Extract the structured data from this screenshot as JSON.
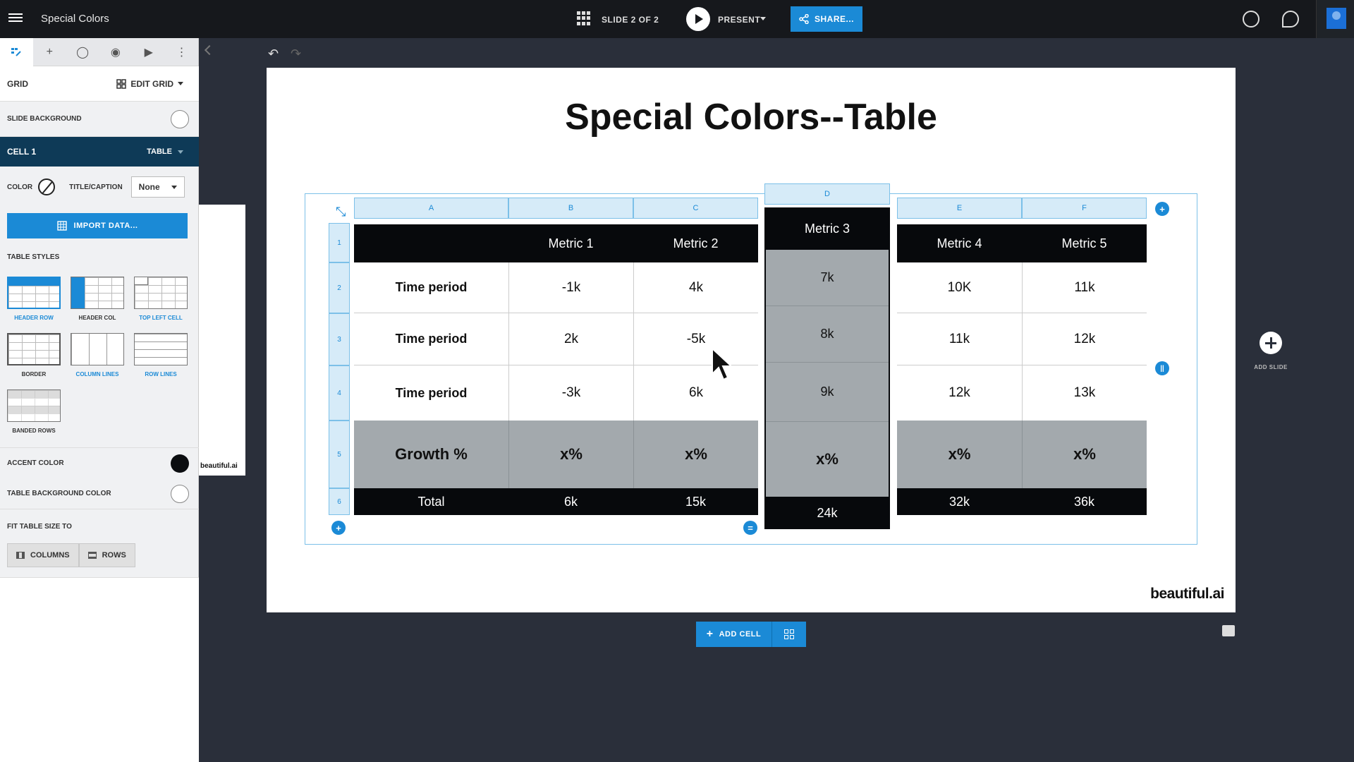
{
  "topbar": {
    "title": "Special Colors",
    "slide_counter": "SLIDE 2 OF 2",
    "present_label": "PRESENT",
    "share_label": "SHARE..."
  },
  "panel": {
    "grid_label": "GRID",
    "edit_grid_label": "EDIT GRID",
    "slide_background_label": "SLIDE BACKGROUND",
    "cell_label": "CELL 1",
    "cell_type": "TABLE",
    "color_label": "COLOR",
    "title_caption_label": "TITLE/CAPTION",
    "title_caption_value": "None",
    "import_label": "IMPORT DATA...",
    "table_styles_label": "TABLE STYLES",
    "styles": [
      {
        "label": "HEADER ROW"
      },
      {
        "label": "HEADER COL"
      },
      {
        "label": "TOP LEFT CELL"
      },
      {
        "label": "BORDER"
      },
      {
        "label": "COLUMN LINES"
      },
      {
        "label": "ROW LINES"
      },
      {
        "label": "BANDED ROWS"
      }
    ],
    "accent_color_label": "ACCENT COLOR",
    "accent_color": "#0b0d10",
    "table_bg_label": "TABLE BACKGROUND COLOR",
    "fit_label": "FIT TABLE SIZE TO",
    "fit_columns": "COLUMNS",
    "fit_rows": "ROWS"
  },
  "thumbnail": {
    "brand": "beautiful.ai"
  },
  "slide": {
    "title": "Special Colors--Table",
    "brand": "beautiful.ai",
    "col_headers": [
      "A",
      "B",
      "C",
      "D",
      "E",
      "F"
    ],
    "row_headers": [
      "1",
      "2",
      "3",
      "4",
      "5",
      "6"
    ],
    "table": {
      "header": [
        "",
        "Metric 1",
        "Metric 2",
        "Metric 3",
        "Metric 4",
        "Metric 5"
      ],
      "rows": [
        [
          "Time period",
          "-1k",
          "4k",
          "7k",
          "10K",
          "11k"
        ],
        [
          "Time period",
          "2k",
          "-5k",
          "8k",
          "11k",
          "12k"
        ],
        [
          "Time period",
          "-3k",
          "6k",
          "9k",
          "12k",
          "13k"
        ]
      ],
      "growth": [
        "Growth %",
        "x%",
        "x%",
        "x%",
        "x%",
        "x%"
      ],
      "total": [
        "Total",
        "6k",
        "15k",
        "24k",
        "32k",
        "36k"
      ]
    }
  },
  "add_slide_label": "ADD SLIDE",
  "add_cell_label": "ADD CELL",
  "colors": {
    "accent_blue": "#1b8ad6",
    "header_dark": "#07090c",
    "growth_gray": "#a3a9ad"
  }
}
